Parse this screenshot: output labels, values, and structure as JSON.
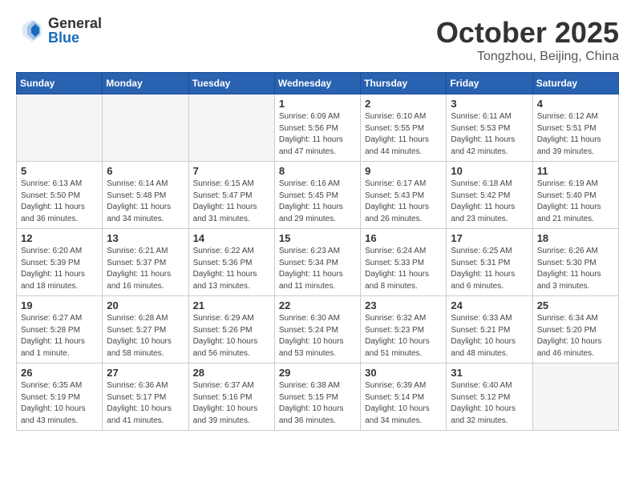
{
  "header": {
    "logo_general": "General",
    "logo_blue": "Blue",
    "month_title": "October 2025",
    "location": "Tongzhou, Beijing, China"
  },
  "weekdays": [
    "Sunday",
    "Monday",
    "Tuesday",
    "Wednesday",
    "Thursday",
    "Friday",
    "Saturday"
  ],
  "weeks": [
    [
      {
        "day": "",
        "info": ""
      },
      {
        "day": "",
        "info": ""
      },
      {
        "day": "",
        "info": ""
      },
      {
        "day": "1",
        "info": "Sunrise: 6:09 AM\nSunset: 5:56 PM\nDaylight: 11 hours\nand 47 minutes."
      },
      {
        "day": "2",
        "info": "Sunrise: 6:10 AM\nSunset: 5:55 PM\nDaylight: 11 hours\nand 44 minutes."
      },
      {
        "day": "3",
        "info": "Sunrise: 6:11 AM\nSunset: 5:53 PM\nDaylight: 11 hours\nand 42 minutes."
      },
      {
        "day": "4",
        "info": "Sunrise: 6:12 AM\nSunset: 5:51 PM\nDaylight: 11 hours\nand 39 minutes."
      }
    ],
    [
      {
        "day": "5",
        "info": "Sunrise: 6:13 AM\nSunset: 5:50 PM\nDaylight: 11 hours\nand 36 minutes."
      },
      {
        "day": "6",
        "info": "Sunrise: 6:14 AM\nSunset: 5:48 PM\nDaylight: 11 hours\nand 34 minutes."
      },
      {
        "day": "7",
        "info": "Sunrise: 6:15 AM\nSunset: 5:47 PM\nDaylight: 11 hours\nand 31 minutes."
      },
      {
        "day": "8",
        "info": "Sunrise: 6:16 AM\nSunset: 5:45 PM\nDaylight: 11 hours\nand 29 minutes."
      },
      {
        "day": "9",
        "info": "Sunrise: 6:17 AM\nSunset: 5:43 PM\nDaylight: 11 hours\nand 26 minutes."
      },
      {
        "day": "10",
        "info": "Sunrise: 6:18 AM\nSunset: 5:42 PM\nDaylight: 11 hours\nand 23 minutes."
      },
      {
        "day": "11",
        "info": "Sunrise: 6:19 AM\nSunset: 5:40 PM\nDaylight: 11 hours\nand 21 minutes."
      }
    ],
    [
      {
        "day": "12",
        "info": "Sunrise: 6:20 AM\nSunset: 5:39 PM\nDaylight: 11 hours\nand 18 minutes."
      },
      {
        "day": "13",
        "info": "Sunrise: 6:21 AM\nSunset: 5:37 PM\nDaylight: 11 hours\nand 16 minutes."
      },
      {
        "day": "14",
        "info": "Sunrise: 6:22 AM\nSunset: 5:36 PM\nDaylight: 11 hours\nand 13 minutes."
      },
      {
        "day": "15",
        "info": "Sunrise: 6:23 AM\nSunset: 5:34 PM\nDaylight: 11 hours\nand 11 minutes."
      },
      {
        "day": "16",
        "info": "Sunrise: 6:24 AM\nSunset: 5:33 PM\nDaylight: 11 hours\nand 8 minutes."
      },
      {
        "day": "17",
        "info": "Sunrise: 6:25 AM\nSunset: 5:31 PM\nDaylight: 11 hours\nand 6 minutes."
      },
      {
        "day": "18",
        "info": "Sunrise: 6:26 AM\nSunset: 5:30 PM\nDaylight: 11 hours\nand 3 minutes."
      }
    ],
    [
      {
        "day": "19",
        "info": "Sunrise: 6:27 AM\nSunset: 5:28 PM\nDaylight: 11 hours\nand 1 minute."
      },
      {
        "day": "20",
        "info": "Sunrise: 6:28 AM\nSunset: 5:27 PM\nDaylight: 10 hours\nand 58 minutes."
      },
      {
        "day": "21",
        "info": "Sunrise: 6:29 AM\nSunset: 5:26 PM\nDaylight: 10 hours\nand 56 minutes."
      },
      {
        "day": "22",
        "info": "Sunrise: 6:30 AM\nSunset: 5:24 PM\nDaylight: 10 hours\nand 53 minutes."
      },
      {
        "day": "23",
        "info": "Sunrise: 6:32 AM\nSunset: 5:23 PM\nDaylight: 10 hours\nand 51 minutes."
      },
      {
        "day": "24",
        "info": "Sunrise: 6:33 AM\nSunset: 5:21 PM\nDaylight: 10 hours\nand 48 minutes."
      },
      {
        "day": "25",
        "info": "Sunrise: 6:34 AM\nSunset: 5:20 PM\nDaylight: 10 hours\nand 46 minutes."
      }
    ],
    [
      {
        "day": "26",
        "info": "Sunrise: 6:35 AM\nSunset: 5:19 PM\nDaylight: 10 hours\nand 43 minutes."
      },
      {
        "day": "27",
        "info": "Sunrise: 6:36 AM\nSunset: 5:17 PM\nDaylight: 10 hours\nand 41 minutes."
      },
      {
        "day": "28",
        "info": "Sunrise: 6:37 AM\nSunset: 5:16 PM\nDaylight: 10 hours\nand 39 minutes."
      },
      {
        "day": "29",
        "info": "Sunrise: 6:38 AM\nSunset: 5:15 PM\nDaylight: 10 hours\nand 36 minutes."
      },
      {
        "day": "30",
        "info": "Sunrise: 6:39 AM\nSunset: 5:14 PM\nDaylight: 10 hours\nand 34 minutes."
      },
      {
        "day": "31",
        "info": "Sunrise: 6:40 AM\nSunset: 5:12 PM\nDaylight: 10 hours\nand 32 minutes."
      },
      {
        "day": "",
        "info": ""
      }
    ]
  ]
}
